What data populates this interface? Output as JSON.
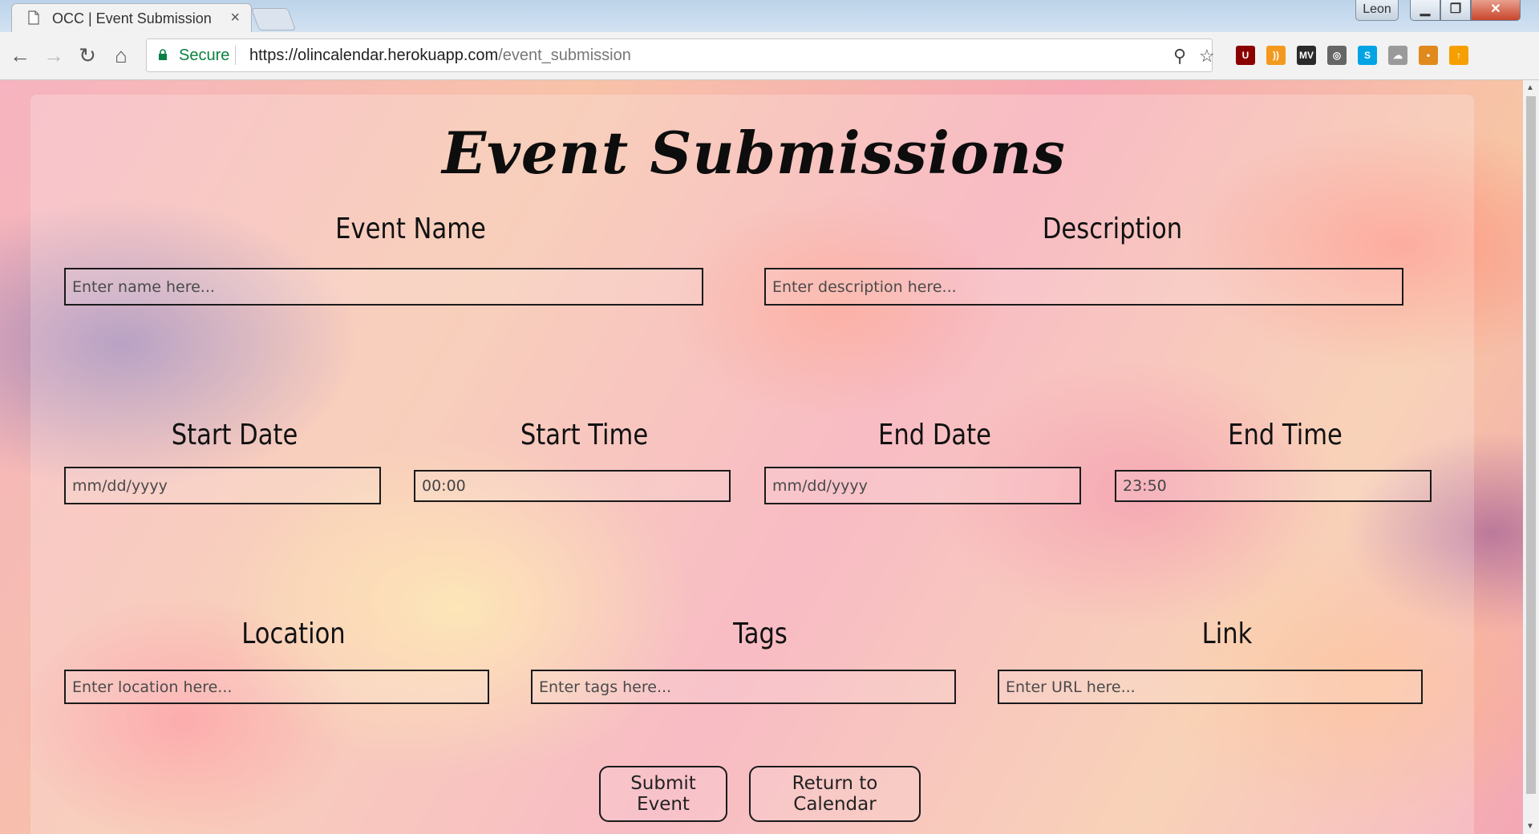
{
  "browser": {
    "tab_title": "OCC | Event Submission",
    "tab_close": "×",
    "user_badge": "Leon",
    "window_buttons": {
      "minimize": "▁",
      "maximize": "❐",
      "close": "✕"
    },
    "secure_label": "Secure",
    "url_base": "https://olincalendar.herokuapp.com",
    "url_path": "/event_submission",
    "nav": {
      "back": "←",
      "forward": "→",
      "reload": "↻",
      "home": "⌂"
    },
    "extensions": [
      {
        "name": "ublock-origin-icon",
        "color": "#8b0000",
        "glyph": "U"
      },
      {
        "name": "rss-icon",
        "color": "#f39a1e",
        "glyph": "))"
      },
      {
        "name": "mv-extension-icon",
        "color": "#2a2a2a",
        "glyph": "MV"
      },
      {
        "name": "globe-extension-icon",
        "color": "#666666",
        "glyph": "◎"
      },
      {
        "name": "skype-icon",
        "color": "#00a4e4",
        "glyph": "S"
      },
      {
        "name": "cloud-extension-icon",
        "color": "#9a9a9a",
        "glyph": "☁"
      },
      {
        "name": "honey-extension-icon",
        "color": "#e08a1e",
        "glyph": "•"
      },
      {
        "name": "upload-extension-icon",
        "color": "#f5a000",
        "glyph": "↑"
      }
    ]
  },
  "page": {
    "title": "Event Submissions",
    "fields": {
      "event_name": {
        "label": "Event Name",
        "placeholder": "Enter name here..."
      },
      "description": {
        "label": "Description",
        "placeholder": "Enter description here..."
      },
      "start_date": {
        "label": "Start Date",
        "placeholder": "mm/dd/yyyy"
      },
      "start_time": {
        "label": "Start Time",
        "value": "00:00"
      },
      "end_date": {
        "label": "End Date",
        "placeholder": "mm/dd/yyyy"
      },
      "end_time": {
        "label": "End Time",
        "value": "23:50"
      },
      "location": {
        "label": "Location",
        "placeholder": "Enter location here..."
      },
      "tags": {
        "label": "Tags",
        "placeholder": "Enter tags here..."
      },
      "link": {
        "label": "Link",
        "placeholder": "Enter URL here..."
      }
    },
    "buttons": {
      "submit": "Submit Event",
      "return": "Return to Calendar"
    }
  }
}
